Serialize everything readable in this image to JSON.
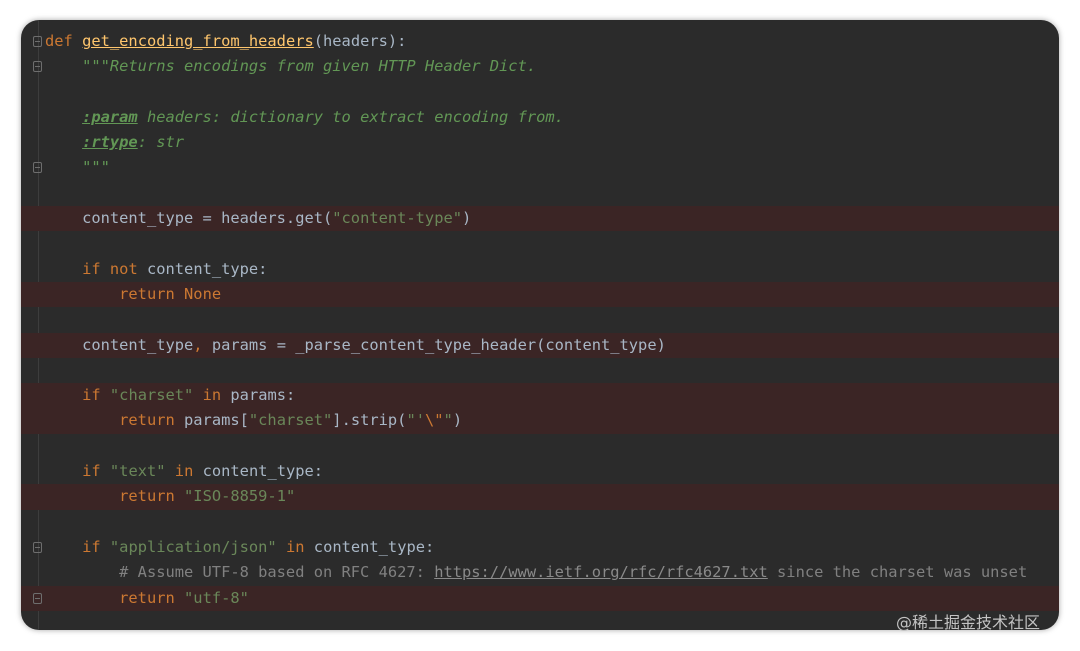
{
  "editor": {
    "theme_colors": {
      "background": "#2b2b2b",
      "keyword": "#cc7832",
      "function": "#ffc66d",
      "string": "#6a8759",
      "docstring": "#629755",
      "comment": "#808080",
      "highlight": "#3b2525"
    },
    "lines": {
      "l1": {
        "kw": "def",
        "sp": " ",
        "fn": "get_encoding_from_headers",
        "rest": "(headers):"
      },
      "l2": {
        "indent": "    ",
        "doc": "\"\"\"Returns encodings from given HTTP Header Dict."
      },
      "l3": {},
      "l4": {
        "indent": "    ",
        "tag": ":param",
        "doc": " headers: dictionary to extract encoding from."
      },
      "l5": {
        "indent": "    ",
        "tag": ":rtype",
        "doc": ": str"
      },
      "l6": {
        "indent": "    ",
        "doc": "\"\"\""
      },
      "l7": {},
      "l8": {
        "indent": "    ",
        "a": "content_type = headers.get(",
        "s": "\"content-type\"",
        "b": ")"
      },
      "l9": {},
      "l10": {
        "indent": "    ",
        "kw1": "if",
        "sp1": " ",
        "kw2": "not",
        "rest": " content_type:"
      },
      "l11": {
        "indent": "        ",
        "kw1": "return",
        "sp1": " ",
        "kw2": "None"
      },
      "l12": {},
      "l13": {
        "indent": "    ",
        "a": "content_type",
        "comma": ",",
        "b": " params = _parse_content_type_header(content_type)"
      },
      "l14": {},
      "l15": {
        "indent": "    ",
        "kw1": "if",
        "sp1": " ",
        "s": "\"charset\"",
        "sp2": " ",
        "kw2": "in",
        "rest": " params:"
      },
      "l16": {
        "indent": "        ",
        "kw1": "return",
        "a": " params[",
        "s1": "\"charset\"",
        "b": "].strip(",
        "s2": "\"'",
        "esc": "\\\"",
        "s3": "\"",
        "c": ")"
      },
      "l17": {},
      "l18": {
        "indent": "    ",
        "kw1": "if",
        "sp1": " ",
        "s": "\"text\"",
        "sp2": " ",
        "kw2": "in",
        "rest": " content_type:"
      },
      "l19": {
        "indent": "        ",
        "kw1": "return",
        "sp1": " ",
        "s": "\"ISO-8859-1\""
      },
      "l20": {},
      "l21": {
        "indent": "    ",
        "kw1": "if",
        "sp1": " ",
        "s": "\"application/json\"",
        "sp2": " ",
        "kw2": "in",
        "rest": " content_type:"
      },
      "l22": {
        "indent": "        ",
        "cmt": "# Assume UTF-8 based on RFC 4627: ",
        "url": "https://www.ietf.org/rfc/rfc4627.txt",
        "cmt2": " since the charset was unset"
      },
      "l23": {
        "indent": "        ",
        "kw1": "return",
        "sp1": " ",
        "s": "\"utf-8\""
      }
    }
  },
  "watermark": "@稀土掘金技术社区"
}
